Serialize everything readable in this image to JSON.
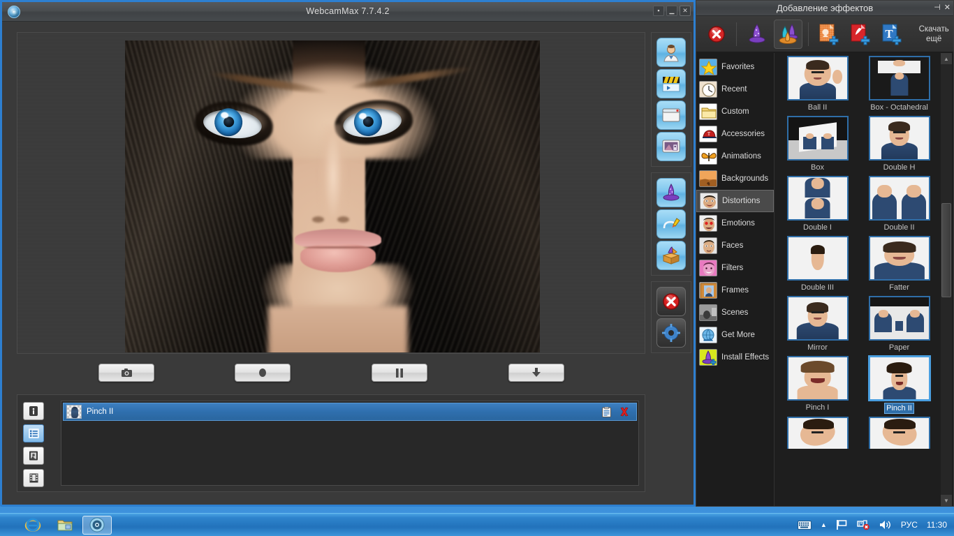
{
  "main_window": {
    "title": "WebcamMax  7.7.4.2",
    "logo_icon": "webcam-logo-icon",
    "window_buttons": [
      {
        "name": "maximize-button",
        "glyph": "▪"
      },
      {
        "name": "minimize-button",
        "glyph": "▁"
      },
      {
        "name": "close-button",
        "glyph": "✕"
      }
    ],
    "controls": [
      {
        "name": "snapshot-button",
        "icon": "camera-icon"
      },
      {
        "name": "record-button",
        "icon": "record-circle-icon"
      },
      {
        "name": "pause-button",
        "icon": "pause-icon"
      },
      {
        "name": "save-button",
        "icon": "download-arrow-icon"
      }
    ],
    "list_side_buttons": [
      {
        "name": "info-button",
        "icon": "info-icon",
        "active": false
      },
      {
        "name": "effect-list-button",
        "icon": "list-icon",
        "active": true
      },
      {
        "name": "picture-button",
        "icon": "picture-icon",
        "active": false
      },
      {
        "name": "film-button",
        "icon": "film-icon",
        "active": false
      }
    ],
    "applied_effects": [
      {
        "name": "Pinch II",
        "thumb": "pinch-thumb",
        "actions": [
          "settings-icon",
          "remove-icon"
        ]
      }
    ],
    "tool_strip": [
      {
        "group": 1,
        "items": [
          {
            "name": "source-person-icon"
          },
          {
            "name": "media-clip-icon"
          },
          {
            "name": "window-icon"
          },
          {
            "name": "desktop-capture-icon"
          }
        ]
      },
      {
        "group": 2,
        "items": [
          {
            "name": "effects-hat-icon"
          },
          {
            "name": "doodle-pencil-icon"
          },
          {
            "name": "effect-box-icon"
          }
        ]
      },
      {
        "group": 3,
        "items": [
          {
            "name": "close-red-icon"
          },
          {
            "name": "settings-gear-icon"
          }
        ]
      }
    ]
  },
  "effects_panel": {
    "title": "Добавление эффектов",
    "window_buttons": [
      {
        "name": "pin-button",
        "glyph": "⊣"
      },
      {
        "name": "close-button",
        "glyph": "✕"
      }
    ],
    "toolbar": {
      "clear_icon": "clear-effects-icon",
      "single_effect_icon": "single-hat-icon",
      "multi_effect_icon": "multi-hat-icon",
      "add_image_icon": "add-image-icon",
      "add_flash_icon": "add-flash-icon",
      "add_text_icon": "add-text-icon",
      "download_more_line1": "Скачать",
      "download_more_line2": "ещё"
    },
    "categories": [
      {
        "label": "Favorites",
        "icon": "star-icon",
        "selected": false
      },
      {
        "label": "Recent",
        "icon": "clock-icon",
        "selected": false
      },
      {
        "label": "Custom",
        "icon": "folder-icon",
        "selected": false
      },
      {
        "label": "Accessories",
        "icon": "cap-icon",
        "selected": false
      },
      {
        "label": "Animations",
        "icon": "butterfly-icon",
        "selected": false
      },
      {
        "label": "Backgrounds",
        "icon": "desert-icon",
        "selected": false
      },
      {
        "label": "Distortions",
        "icon": "distort-face-icon",
        "selected": true
      },
      {
        "label": "Emotions",
        "icon": "emotion-face-icon",
        "selected": false
      },
      {
        "label": "Faces",
        "icon": "face-icon",
        "selected": false
      },
      {
        "label": "Filters",
        "icon": "filter-face-icon",
        "selected": false
      },
      {
        "label": "Frames",
        "icon": "frame-icon",
        "selected": false
      },
      {
        "label": "Scenes",
        "icon": "scene-icon",
        "selected": false
      },
      {
        "label": "Get More",
        "icon": "globe-icon",
        "selected": false
      },
      {
        "label": "Install Effects",
        "icon": "install-hat-icon",
        "selected": false
      }
    ],
    "effects": [
      {
        "label": "Ball II",
        "selected": false
      },
      {
        "label": "Box - Octahedral",
        "selected": false
      },
      {
        "label": "Box",
        "selected": false
      },
      {
        "label": "Double H",
        "selected": false
      },
      {
        "label": "Double I",
        "selected": false
      },
      {
        "label": "Double II",
        "selected": false
      },
      {
        "label": "Double III",
        "selected": false
      },
      {
        "label": "Fatter",
        "selected": false
      },
      {
        "label": "Mirror",
        "selected": false
      },
      {
        "label": "Paper",
        "selected": false
      },
      {
        "label": "Pinch I",
        "selected": false
      },
      {
        "label": "Pinch II",
        "selected": true
      },
      {
        "label": "",
        "selected": false
      },
      {
        "label": "",
        "selected": false
      }
    ],
    "scrollbar": {
      "up_glyph": "▲",
      "down_glyph": "▼"
    }
  },
  "taskbar": {
    "items": [
      {
        "name": "taskbar-internet-explorer",
        "icon": "ie-icon",
        "active": false
      },
      {
        "name": "taskbar-explorer",
        "icon": "folder-icon",
        "active": false
      },
      {
        "name": "taskbar-webcammax",
        "icon": "webcam-icon",
        "active": true
      }
    ],
    "tray": {
      "keyboard_icon": "keyboard-icon",
      "show_hidden_glyph": "▲",
      "flag_icon": "flag-icon",
      "network_icon": "network-error-icon",
      "volume_icon": "speaker-icon",
      "language": "РУС",
      "clock": "11:30"
    }
  },
  "colors": {
    "accent_blue": "#2f6ea8",
    "selection_blue": "#2a7fd4",
    "panel_dark": "#1e1e1e",
    "window_gray": "#3a3a3a"
  }
}
